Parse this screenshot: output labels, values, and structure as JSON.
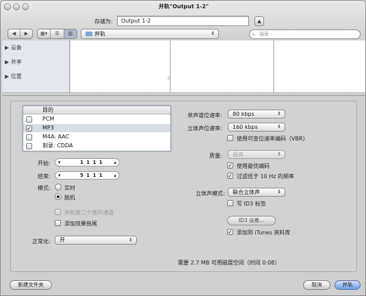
{
  "window": {
    "title": "并轨\"Output 1-2\""
  },
  "save": {
    "label": "存储为:",
    "filename": "Output 1-2",
    "toggle_icon": "chevron-up-icon",
    "location": "并轨",
    "search_placeholder": "搜索"
  },
  "sidebar": {
    "items": [
      {
        "label": "设备"
      },
      {
        "label": "共享"
      },
      {
        "label": "位置"
      }
    ]
  },
  "table": {
    "header": "目的",
    "rows": [
      {
        "label": "PCM",
        "checked": false
      },
      {
        "label": "MP3",
        "checked": true
      },
      {
        "label": "M4A: AAC",
        "checked": false
      },
      {
        "label": "刻录: CDDA",
        "checked": false
      }
    ]
  },
  "left": {
    "start_label": "开始:",
    "start_value": "1  1  1  1",
    "end_label": "结束:",
    "end_value": "5  1  1  1",
    "mode_label": "模式:",
    "mode_realtime": "实时",
    "mode_offline": "脱机",
    "mode_selected": "offline",
    "bypass_label": "并轨第二个循环通道",
    "bypass_checked": false,
    "tail_label": "添加效果拖尾",
    "tail_checked": false,
    "normalize_label": "正常化:",
    "normalize_value": "开"
  },
  "right": {
    "mono_label": "单声道位速率:",
    "mono_value": "80 kbps",
    "stereo_label": "立体声位速率:",
    "stereo_value": "160 kbps",
    "vbr_label": "使用可变位速率编码（VBR）",
    "vbr_checked": false,
    "quality_label": "质量:",
    "quality_value": "最高",
    "best_encoding_label": "使用最优编码",
    "best_encoding_checked": true,
    "filter_label": "过滤低于 10 Hz 的频率",
    "filter_checked": true,
    "stereo_mode_label": "立体声模式:",
    "stereo_mode_value": "联合立体声",
    "id3_label": "写 ID3 标签",
    "id3_checked": false,
    "id3_settings_button": "ID3 设置...",
    "itunes_label": "添加到 iTunes 资料库",
    "itunes_checked": true
  },
  "status": {
    "text": "需要 2.7 MB 可用磁盘空间（时间 0:08）"
  },
  "footer": {
    "new_folder": "新建文件夹",
    "cancel": "取消",
    "bounce": "并轨"
  }
}
